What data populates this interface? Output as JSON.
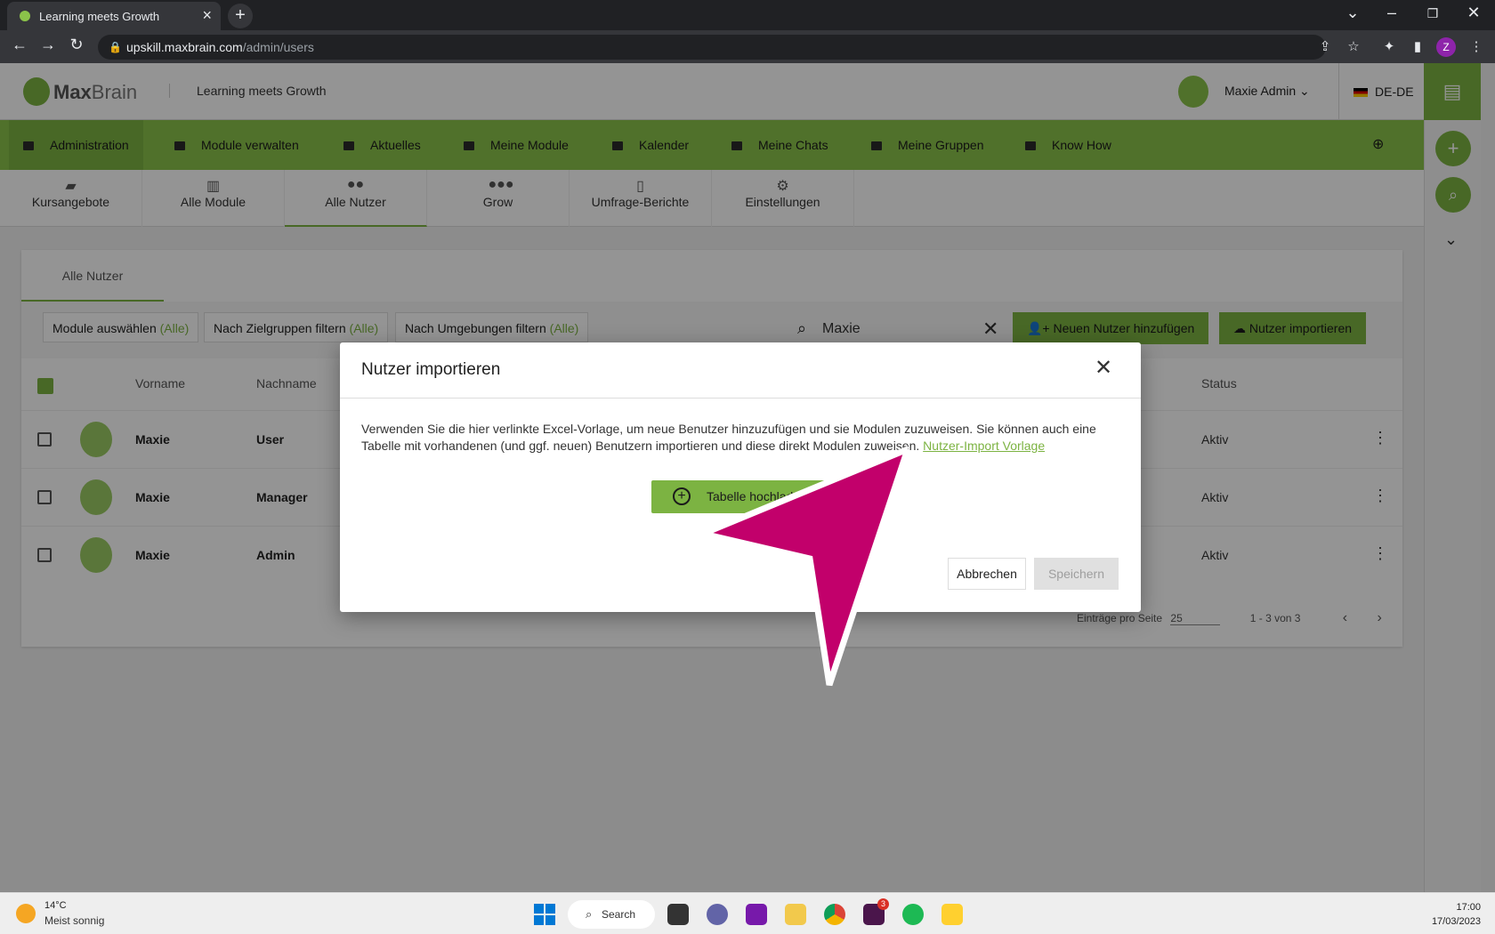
{
  "browser": {
    "tab_title": "Learning meets Growth",
    "url_host": "upskill.maxbrain.com",
    "url_path": "/admin/users",
    "profile_initial": "Z"
  },
  "header": {
    "brand_bold": "Max",
    "brand_light": "Brain",
    "tagline": "Learning meets Growth",
    "user_name": "Maxie Admin",
    "language": "DE-DE"
  },
  "main_nav": [
    {
      "label": "Administration"
    },
    {
      "label": "Module verwalten"
    },
    {
      "label": "Aktuelles"
    },
    {
      "label": "Meine Module"
    },
    {
      "label": "Kalender"
    },
    {
      "label": "Meine Chats"
    },
    {
      "label": "Meine Gruppen"
    },
    {
      "label": "Know How"
    }
  ],
  "sub_tabs": [
    {
      "label": "Kursangebote"
    },
    {
      "label": "Alle Module"
    },
    {
      "label": "Alle Nutzer"
    },
    {
      "label": "Grow"
    },
    {
      "label": "Umfrage-Berichte"
    },
    {
      "label": "Einstellungen"
    }
  ],
  "card": {
    "tab": "Alle Nutzer",
    "filters": [
      {
        "label": "Module auswählen",
        "value": "(Alle)"
      },
      {
        "label": "Nach Zielgruppen filtern",
        "value": "(Alle)"
      },
      {
        "label": "Nach Umgebungen filtern",
        "value": "(Alle)"
      }
    ],
    "search_value": "Maxie",
    "add_user_label": "Neuen Nutzer hinzufügen",
    "import_label": "Nutzer importieren",
    "columns": {
      "firstname": "Vorname",
      "lastname": "Nachname",
      "status": "Status"
    },
    "rows": [
      {
        "firstname": "Maxie",
        "lastname": "User",
        "status": "Aktiv"
      },
      {
        "firstname": "Maxie",
        "lastname": "Manager",
        "status": "Aktiv"
      },
      {
        "firstname": "Maxie",
        "lastname": "Admin",
        "status": "Aktiv"
      }
    ],
    "pager": {
      "per_page_label": "Einträge pro Seite",
      "per_page": "25",
      "range": "1 - 3 von 3"
    }
  },
  "modal": {
    "title": "Nutzer importieren",
    "body": "Verwenden Sie die hier verlinkte Excel-Vorlage, um neue Benutzer hinzuzufügen und sie Modulen zuzuweisen. Sie können auch eine Tabelle mit vorhandenen (und ggf. neuen) Benutzern importieren und diese direkt Modulen zuweisen.",
    "link": "Nutzer-Import Vorlage",
    "upload_label": "Tabelle hochladen",
    "cancel_label": "Abbrechen",
    "save_label": "Speichern"
  },
  "taskbar": {
    "temperature": "14°C",
    "weather": "Meist sonnig",
    "search_label": "Search",
    "time": "17:00",
    "date": "17/03/2023",
    "slack_badge": "3"
  },
  "colors": {
    "accent": "#8bc34a",
    "accent_dark": "#7cb342",
    "pointer": "#c2006b"
  }
}
